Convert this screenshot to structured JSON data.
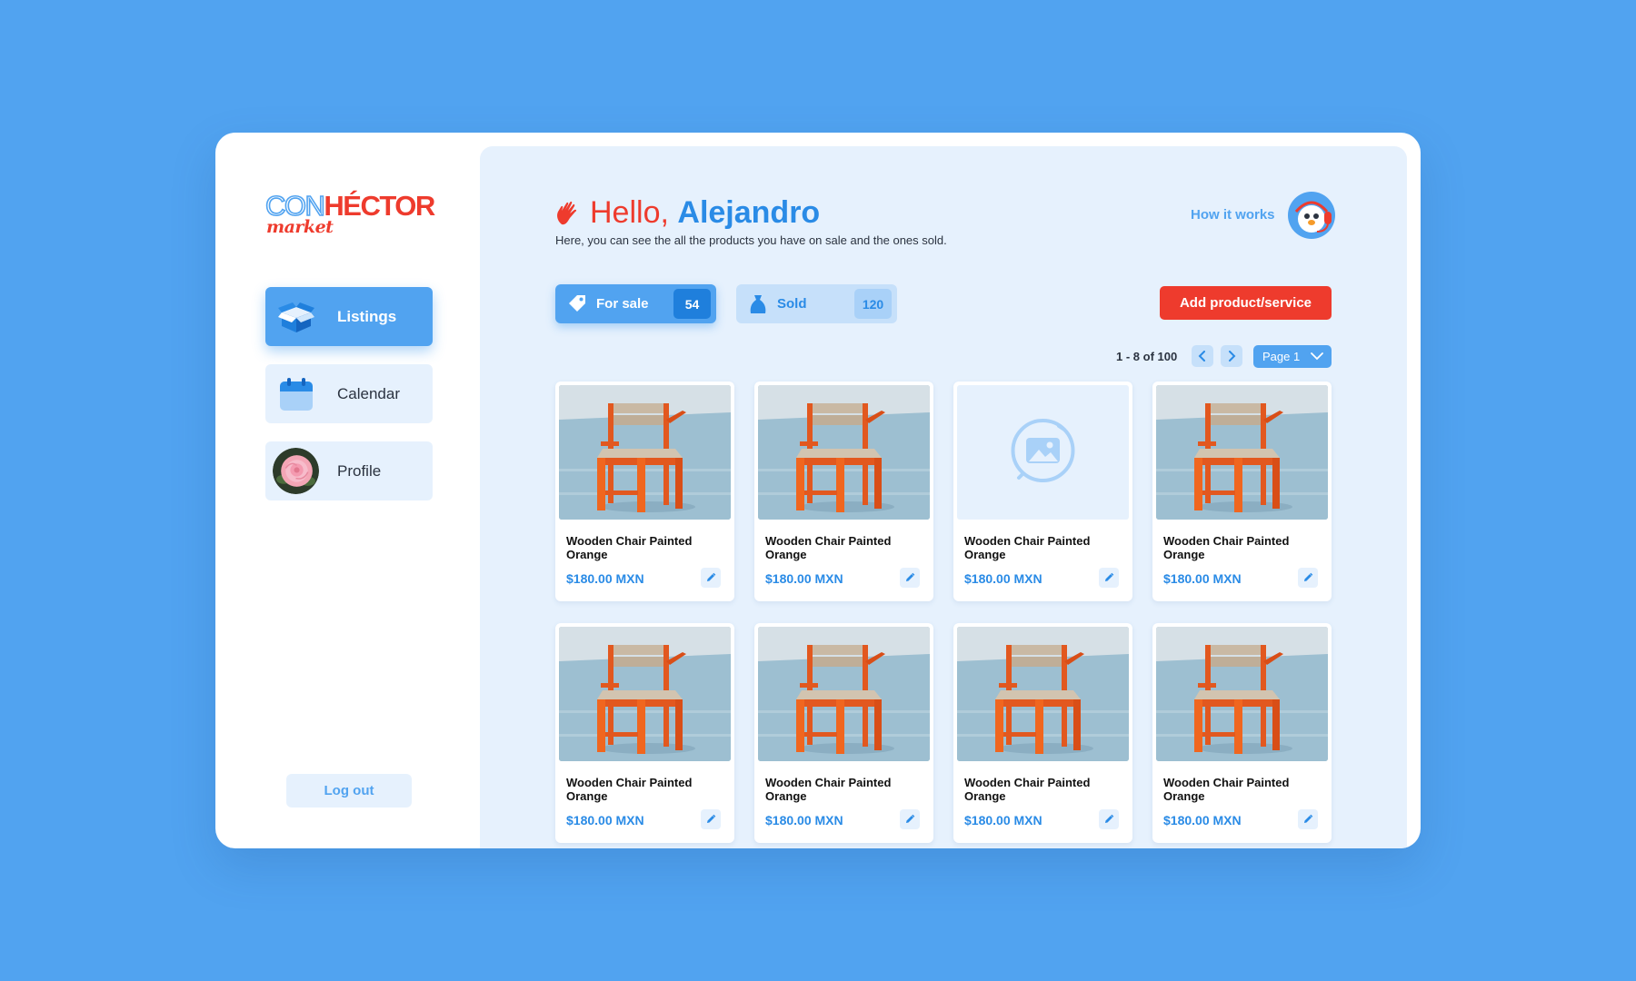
{
  "brand": {
    "logo_part1": "CON",
    "logo_part2": "HÉCTOR",
    "logo_sub": "market"
  },
  "sidebar": {
    "items": [
      {
        "label": "Listings",
        "icon": "box-icon",
        "active": true
      },
      {
        "label": "Calendar",
        "icon": "calendar-icon",
        "active": false
      },
      {
        "label": "Profile",
        "icon": "avatar",
        "active": false
      }
    ],
    "logout_label": "Log out"
  },
  "header": {
    "greeting": "Hello,",
    "user_name": "Alejandro",
    "subtitle": "Here, you can see the all the products you have on sale and the ones sold.",
    "how_it_works": "How it works"
  },
  "filters": {
    "for_sale": {
      "label": "For sale",
      "count": "54",
      "icon": "tag-icon"
    },
    "sold": {
      "label": "Sold",
      "count": "120",
      "icon": "bag-icon"
    }
  },
  "add_button": "Add product/service",
  "pagination": {
    "range": "1 - 8 of 100",
    "page_label": "Page 1"
  },
  "colors": {
    "background": "#51a3f0",
    "accent": "#2a8be6",
    "brand_red": "#ee3b2d",
    "panel": "#e6f1fd"
  },
  "products": [
    {
      "title": "Wooden Chair Painted Orange",
      "price": "$180.00 MXN",
      "has_image": true
    },
    {
      "title": "Wooden Chair Painted Orange",
      "price": "$180.00 MXN",
      "has_image": true
    },
    {
      "title": "Wooden Chair Painted Orange",
      "price": "$180.00 MXN",
      "has_image": false
    },
    {
      "title": "Wooden Chair Painted Orange",
      "price": "$180.00 MXN",
      "has_image": true
    },
    {
      "title": "Wooden Chair Painted Orange",
      "price": "$180.00 MXN",
      "has_image": true
    },
    {
      "title": "Wooden Chair Painted Orange",
      "price": "$180.00 MXN",
      "has_image": true
    },
    {
      "title": "Wooden Chair Painted Orange",
      "price": "$180.00 MXN",
      "has_image": true
    },
    {
      "title": "Wooden Chair Painted Orange",
      "price": "$180.00 MXN",
      "has_image": true
    }
  ]
}
